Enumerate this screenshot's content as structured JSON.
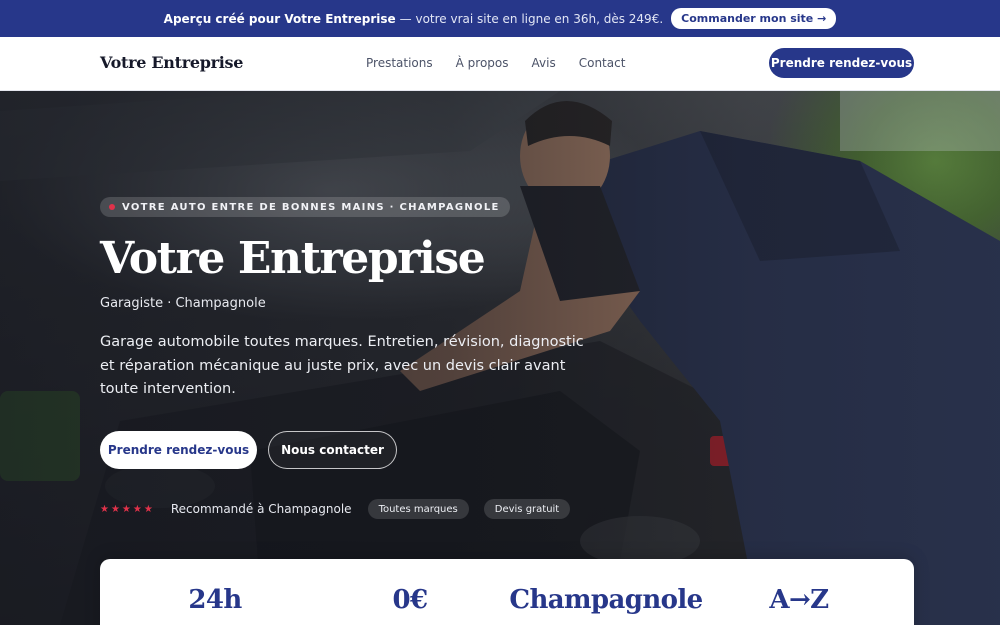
{
  "promo": {
    "strong": "Aperçu créé pour Votre Entreprise",
    "rest": "— votre vrai site en ligne en 36h, dès 249€.",
    "cta": "Commander mon site →"
  },
  "nav": {
    "brand": "Votre Entreprise",
    "links": [
      "Prestations",
      "À propos",
      "Avis",
      "Contact"
    ],
    "cta": "Prendre rendez-vous"
  },
  "hero": {
    "eyebrow": "VOTRE AUTO ENTRE DE BONNES MAINS · CHAMPAGNOLE",
    "title": "Votre Entreprise",
    "subtitle": "Garagiste · Champagnole",
    "description": "Garage automobile toutes marques. Entretien, révision, diagnostic et réparation mécanique au juste prix, avec un devis clair avant toute intervention.",
    "primary_cta": "Prendre rendez-vous",
    "secondary_cta": "Nous contacter",
    "rating_stars": "★★★★★",
    "trust_text": "Recommandé à Champagnole",
    "pills": [
      "Toutes marques",
      "Devis gratuit"
    ]
  },
  "stats": [
    "24h",
    "0€",
    "Champagnole",
    "A→Z"
  ],
  "colors": {
    "brand_blue": "#27378a",
    "accent_red": "#e0324a",
    "white": "#ffffff"
  }
}
